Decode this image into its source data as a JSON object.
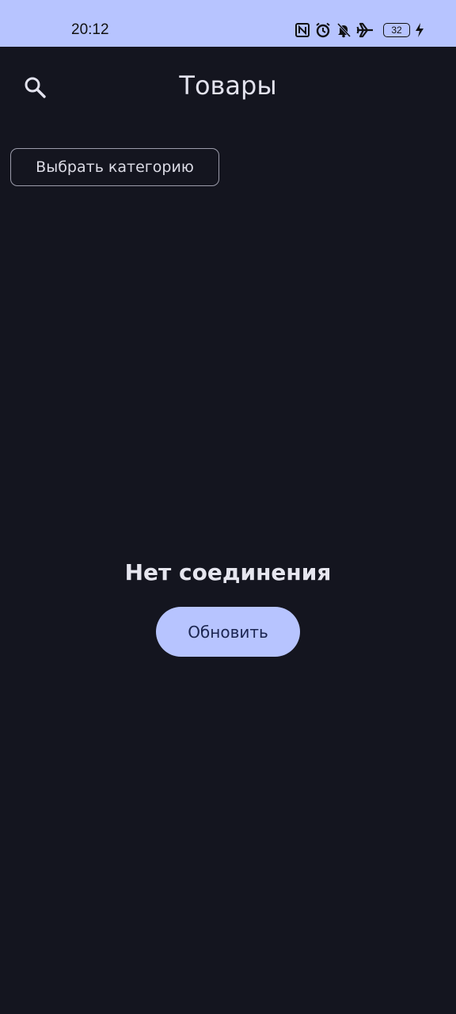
{
  "status_bar": {
    "time": "20:12",
    "battery": "32",
    "icons": [
      "nfc-icon",
      "alarm-icon",
      "bell-off-icon",
      "airplane-icon",
      "battery-icon",
      "charging-icon"
    ]
  },
  "app_bar": {
    "title": "Товары",
    "search_icon": "search-icon"
  },
  "filters": {
    "category_button": "Выбрать категорию"
  },
  "error_state": {
    "message": "Нет соединения",
    "refresh_button": "Обновить"
  },
  "colors": {
    "background": "#14151f",
    "accent": "#b7c4ff",
    "accent_text": "#1b2550",
    "text_primary": "#e6e6ef",
    "outline": "#9c9cab"
  }
}
